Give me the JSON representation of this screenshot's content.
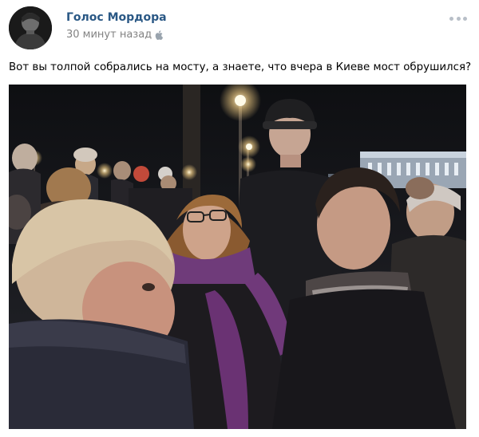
{
  "post": {
    "author": "Голос Мордора",
    "time": "30 минут назад",
    "platform_icon": "apple-icon",
    "menu_icon": "more-icon",
    "text": "Вот вы толпой собрались на мосту, а знаете, что вчера в Киеве мост обрушился?",
    "photo_icon": "crowd-photo"
  },
  "colors": {
    "author": "#2a5885",
    "meta": "#828282",
    "menu_dots": "#b8bfc8"
  }
}
